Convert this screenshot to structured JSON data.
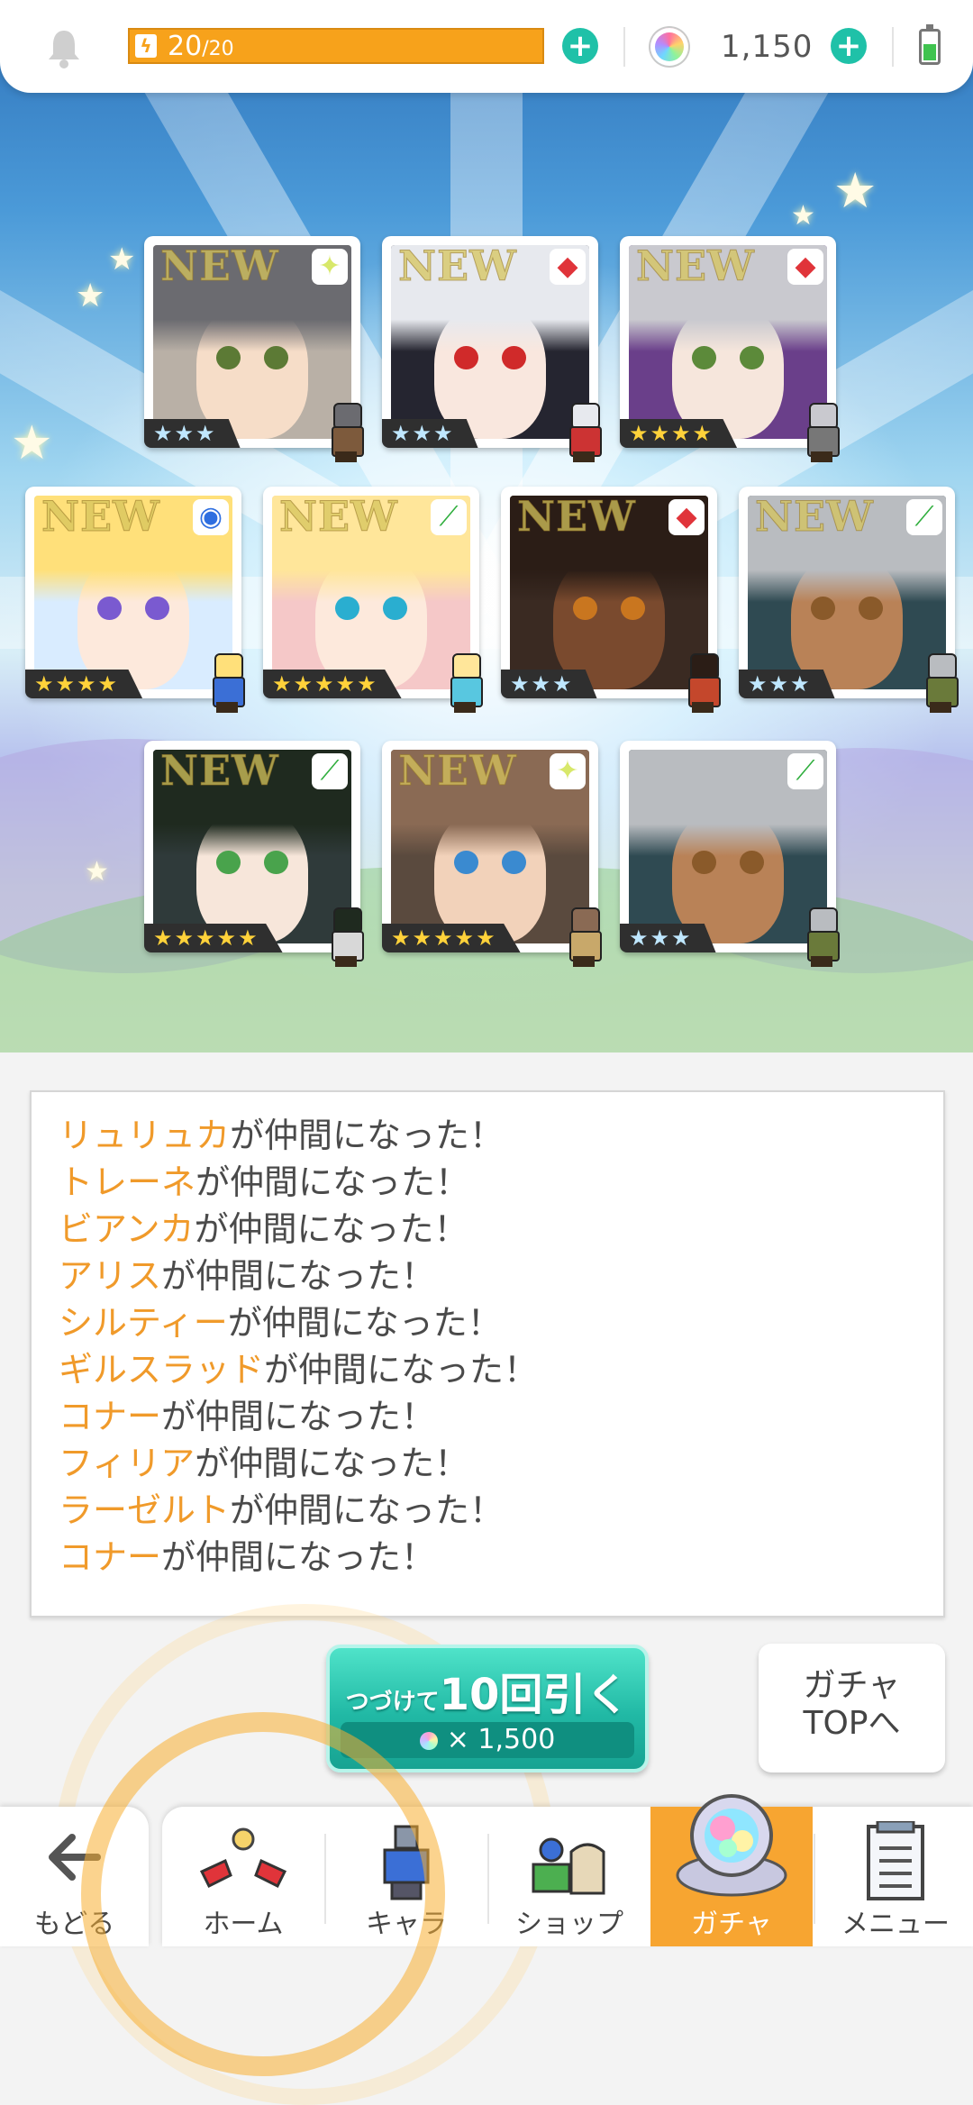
{
  "status": {
    "stamina_current": "20",
    "stamina_max": "/20",
    "stamina_fill": 1.0,
    "gems": "1,150",
    "battery_level": 0.5
  },
  "cards": [
    {
      "rarity": "★★★",
      "is_new": true,
      "new_text": "NEW",
      "element": "light",
      "element_glyph": "✦"
    },
    {
      "rarity": "★★★",
      "is_new": true,
      "new_text": "NEW",
      "element": "fire",
      "element_glyph": "◆"
    },
    {
      "rarity": "★★★★",
      "is_new": true,
      "new_text": "NEW",
      "element": "fire",
      "element_glyph": "◆"
    },
    {
      "rarity": "★★★★",
      "is_new": true,
      "new_text": "NEW",
      "element": "water",
      "element_glyph": "◉"
    },
    {
      "rarity": "★★★★★",
      "is_new": true,
      "new_text": "NEW",
      "element": "wind",
      "element_glyph": "⟋"
    },
    {
      "rarity": "★★★",
      "is_new": true,
      "new_text": "NEW",
      "element": "fire",
      "element_glyph": "◆"
    },
    {
      "rarity": "★★★",
      "is_new": true,
      "new_text": "NEW",
      "element": "wind",
      "element_glyph": "⟋"
    },
    {
      "rarity": "★★★★★",
      "is_new": true,
      "new_text": "NEW",
      "element": "wind",
      "element_glyph": "⟋"
    },
    {
      "rarity": "★★★★★",
      "is_new": true,
      "new_text": "NEW",
      "element": "light",
      "element_glyph": "✦"
    },
    {
      "rarity": "★★★",
      "is_new": false,
      "new_text": "",
      "element": "wind",
      "element_glyph": "⟋"
    }
  ],
  "messages": [
    {
      "name": "リュリュカ",
      "suffix": "が仲間になった！"
    },
    {
      "name": "トレーネ",
      "suffix": "が仲間になった！"
    },
    {
      "name": "ビアンカ",
      "suffix": "が仲間になった！"
    },
    {
      "name": "アリス",
      "suffix": "が仲間になった！"
    },
    {
      "name": "シルティー",
      "suffix": "が仲間になった！"
    },
    {
      "name": "ギルスラッド",
      "suffix": "が仲間になった！"
    },
    {
      "name": "コナー",
      "suffix": "が仲間になった！"
    },
    {
      "name": "フィリア",
      "suffix": "が仲間になった！"
    },
    {
      "name": "ラーゼルト",
      "suffix": "が仲間になった！"
    },
    {
      "name": "コナー",
      "suffix": "が仲間になった！"
    }
  ],
  "pull_button": {
    "prefix": "つづけて",
    "main": "10回引く",
    "cost": "× 1,500"
  },
  "gacha_top": {
    "line1": "ガチャ",
    "line2": "TOPへ"
  },
  "nav": {
    "back": "もどる",
    "home": "ホーム",
    "chara": "キャラ",
    "shop": "ショップ",
    "gacha": "ガチャ",
    "menu": "メニュー"
  },
  "colors": {
    "accent_orange": "#f7a21b",
    "accent_teal": "#1fc1a8",
    "name_orange": "#f09a2a",
    "nav_active": "#f7a531"
  },
  "icons": [
    "bell-icon",
    "bolt-icon",
    "plus-icon",
    "gem-icon",
    "battery-icon",
    "back-arrow-icon",
    "home-icon",
    "chara-icon",
    "shop-icon",
    "gacha-icon",
    "menu-icon"
  ]
}
